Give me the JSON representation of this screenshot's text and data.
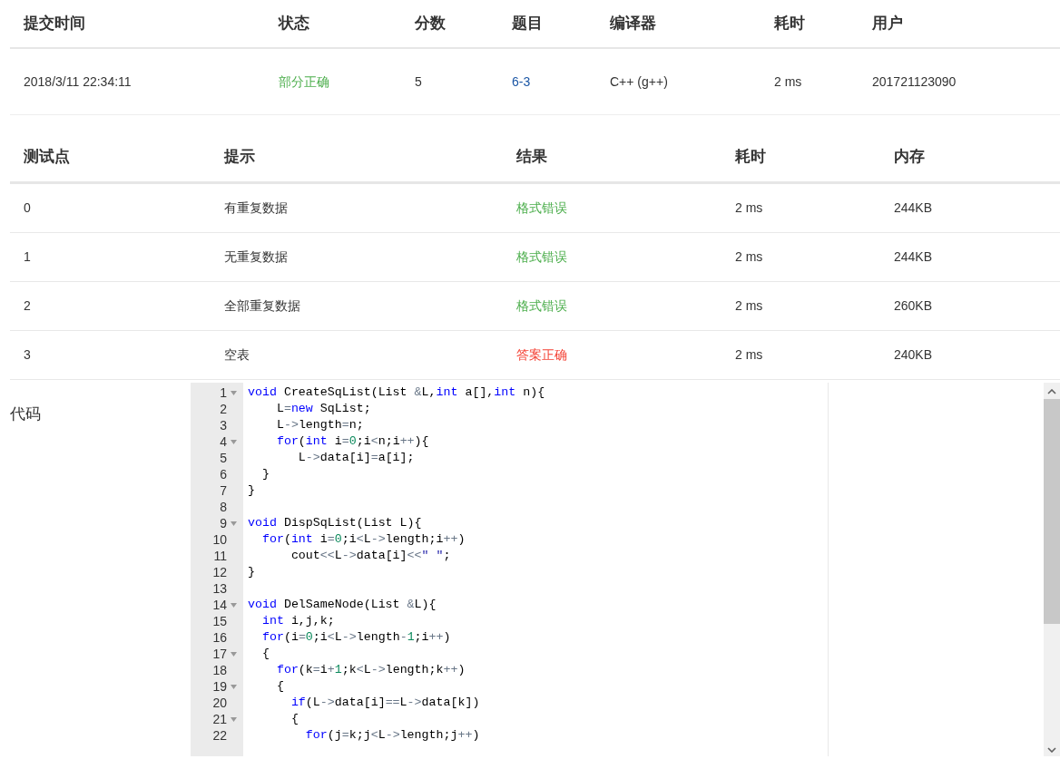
{
  "submission": {
    "columns": [
      "提交时间",
      "状态",
      "分数",
      "题目",
      "编译器",
      "耗时",
      "用户"
    ],
    "row": {
      "time": "2018/3/11 22:34:11",
      "status": {
        "text": "部分正确",
        "color": "#4cae4c"
      },
      "score": "5",
      "problem": "6-3",
      "compiler": "C++ (g++)",
      "duration": "2 ms",
      "user": "201721123090"
    }
  },
  "tests": {
    "columns": [
      "测试点",
      "提示",
      "结果",
      "耗时",
      "内存"
    ],
    "rows": [
      {
        "id": "0",
        "hint": "有重复数据",
        "result": {
          "text": "格式错误",
          "color": "#4cae4c"
        },
        "duration": "2 ms",
        "memory": "244KB"
      },
      {
        "id": "1",
        "hint": "无重复数据",
        "result": {
          "text": "格式错误",
          "color": "#4cae4c"
        },
        "duration": "2 ms",
        "memory": "244KB"
      },
      {
        "id": "2",
        "hint": "全部重复数据",
        "result": {
          "text": "格式错误",
          "color": "#4cae4c"
        },
        "duration": "2 ms",
        "memory": "260KB"
      },
      {
        "id": "3",
        "hint": "空表",
        "result": {
          "text": "答案正确",
          "color": "#f44336"
        },
        "duration": "2 ms",
        "memory": "240KB"
      }
    ]
  },
  "code": {
    "label": "代码",
    "lines": [
      {
        "number": "1",
        "foldable": true,
        "tokens": [
          {
            "t": "void",
            "kind": "keyword"
          },
          {
            "t": " CreateSqList(List ",
            "kind": "plain"
          },
          {
            "t": "&",
            "kind": "operator"
          },
          {
            "t": "L,",
            "kind": "plain"
          },
          {
            "t": "int",
            "kind": "keyword"
          },
          {
            "t": " a[],",
            "kind": "plain"
          },
          {
            "t": "int",
            "kind": "keyword"
          },
          {
            "t": " n){",
            "kind": "plain"
          }
        ]
      },
      {
        "number": "2",
        "foldable": false,
        "tokens": [
          {
            "t": "    L",
            "kind": "plain"
          },
          {
            "t": "=",
            "kind": "operator"
          },
          {
            "t": "new",
            "kind": "keyword"
          },
          {
            "t": " SqList;",
            "kind": "plain"
          }
        ]
      },
      {
        "number": "3",
        "foldable": false,
        "tokens": [
          {
            "t": "    L",
            "kind": "plain"
          },
          {
            "t": "->",
            "kind": "operator"
          },
          {
            "t": "length",
            "kind": "plain"
          },
          {
            "t": "=",
            "kind": "operator"
          },
          {
            "t": "n;",
            "kind": "plain"
          }
        ]
      },
      {
        "number": "4",
        "foldable": true,
        "tokens": [
          {
            "t": "    for",
            "kind": "keyword"
          },
          {
            "t": "(",
            "kind": "plain"
          },
          {
            "t": "int",
            "kind": "keyword"
          },
          {
            "t": " i",
            "kind": "plain"
          },
          {
            "t": "=",
            "kind": "operator"
          },
          {
            "t": "0",
            "kind": "number"
          },
          {
            "t": ";i",
            "kind": "plain"
          },
          {
            "t": "<",
            "kind": "operator"
          },
          {
            "t": "n;i",
            "kind": "plain"
          },
          {
            "t": "++",
            "kind": "operator"
          },
          {
            "t": "){",
            "kind": "plain"
          }
        ]
      },
      {
        "number": "5",
        "foldable": false,
        "tokens": [
          {
            "t": "       L",
            "kind": "plain"
          },
          {
            "t": "->",
            "kind": "operator"
          },
          {
            "t": "data[i]",
            "kind": "plain"
          },
          {
            "t": "=",
            "kind": "operator"
          },
          {
            "t": "a[i];",
            "kind": "plain"
          }
        ]
      },
      {
        "number": "6",
        "foldable": false,
        "tokens": [
          {
            "t": "  }",
            "kind": "plain"
          }
        ]
      },
      {
        "number": "7",
        "foldable": false,
        "tokens": [
          {
            "t": "}",
            "kind": "plain"
          }
        ]
      },
      {
        "number": "8",
        "foldable": false
      },
      {
        "number": "9",
        "foldable": true,
        "tokens": [
          {
            "t": "void",
            "kind": "keyword"
          },
          {
            "t": " DispSqList(List L){",
            "kind": "plain"
          }
        ]
      },
      {
        "number": "10",
        "foldable": false,
        "tokens": [
          {
            "t": "  for",
            "kind": "keyword"
          },
          {
            "t": "(",
            "kind": "plain"
          },
          {
            "t": "int",
            "kind": "keyword"
          },
          {
            "t": " i",
            "kind": "plain"
          },
          {
            "t": "=",
            "kind": "operator"
          },
          {
            "t": "0",
            "kind": "number"
          },
          {
            "t": ";i",
            "kind": "plain"
          },
          {
            "t": "<",
            "kind": "operator"
          },
          {
            "t": "L",
            "kind": "plain"
          },
          {
            "t": "->",
            "kind": "operator"
          },
          {
            "t": "length;i",
            "kind": "plain"
          },
          {
            "t": "++",
            "kind": "operator"
          },
          {
            "t": ")",
            "kind": "plain"
          }
        ]
      },
      {
        "number": "11",
        "foldable": false,
        "tokens": [
          {
            "t": "      cout",
            "kind": "plain"
          },
          {
            "t": "<<",
            "kind": "operator"
          },
          {
            "t": "L",
            "kind": "plain"
          },
          {
            "t": "->",
            "kind": "operator"
          },
          {
            "t": "data[i]",
            "kind": "plain"
          },
          {
            "t": "<<",
            "kind": "operator"
          },
          {
            "t": "\" \"",
            "kind": "string"
          },
          {
            "t": ";",
            "kind": "plain"
          }
        ]
      },
      {
        "number": "12",
        "foldable": false,
        "tokens": [
          {
            "t": "}",
            "kind": "plain"
          }
        ]
      },
      {
        "number": "13",
        "foldable": false
      },
      {
        "number": "14",
        "foldable": true,
        "tokens": [
          {
            "t": "void",
            "kind": "keyword"
          },
          {
            "t": " DelSameNode(List ",
            "kind": "plain"
          },
          {
            "t": "&",
            "kind": "operator"
          },
          {
            "t": "L){",
            "kind": "plain"
          }
        ]
      },
      {
        "number": "15",
        "foldable": false,
        "tokens": [
          {
            "t": "  int",
            "kind": "keyword"
          },
          {
            "t": " i,j,k;",
            "kind": "plain"
          }
        ]
      },
      {
        "number": "16",
        "foldable": false,
        "tokens": [
          {
            "t": "  for",
            "kind": "keyword"
          },
          {
            "t": "(i",
            "kind": "plain"
          },
          {
            "t": "=",
            "kind": "operator"
          },
          {
            "t": "0",
            "kind": "number"
          },
          {
            "t": ";i",
            "kind": "plain"
          },
          {
            "t": "<",
            "kind": "operator"
          },
          {
            "t": "L",
            "kind": "plain"
          },
          {
            "t": "->",
            "kind": "operator"
          },
          {
            "t": "length",
            "kind": "plain"
          },
          {
            "t": "-",
            "kind": "operator"
          },
          {
            "t": "1",
            "kind": "number"
          },
          {
            "t": ";i",
            "kind": "plain"
          },
          {
            "t": "++",
            "kind": "operator"
          },
          {
            "t": ")",
            "kind": "plain"
          }
        ]
      },
      {
        "number": "17",
        "foldable": true,
        "tokens": [
          {
            "t": "  {",
            "kind": "plain"
          }
        ]
      },
      {
        "number": "18",
        "foldable": false,
        "tokens": [
          {
            "t": "    for",
            "kind": "keyword"
          },
          {
            "t": "(k",
            "kind": "plain"
          },
          {
            "t": "=",
            "kind": "operator"
          },
          {
            "t": "i",
            "kind": "plain"
          },
          {
            "t": "+",
            "kind": "operator"
          },
          {
            "t": "1",
            "kind": "number"
          },
          {
            "t": ";k",
            "kind": "plain"
          },
          {
            "t": "<",
            "kind": "operator"
          },
          {
            "t": "L",
            "kind": "plain"
          },
          {
            "t": "->",
            "kind": "operator"
          },
          {
            "t": "length;k",
            "kind": "plain"
          },
          {
            "t": "++",
            "kind": "operator"
          },
          {
            "t": ")",
            "kind": "plain"
          }
        ]
      },
      {
        "number": "19",
        "foldable": true,
        "tokens": [
          {
            "t": "    {",
            "kind": "plain"
          }
        ]
      },
      {
        "number": "20",
        "foldable": false,
        "tokens": [
          {
            "t": "      if",
            "kind": "keyword"
          },
          {
            "t": "(L",
            "kind": "plain"
          },
          {
            "t": "->",
            "kind": "operator"
          },
          {
            "t": "data[i]",
            "kind": "plain"
          },
          {
            "t": "==",
            "kind": "operator"
          },
          {
            "t": "L",
            "kind": "plain"
          },
          {
            "t": "->",
            "kind": "operator"
          },
          {
            "t": "data[k])",
            "kind": "plain"
          }
        ]
      },
      {
        "number": "21",
        "foldable": true,
        "tokens": [
          {
            "t": "      {",
            "kind": "plain"
          }
        ]
      },
      {
        "number": "22",
        "foldable": false,
        "tokens": [
          {
            "t": "        for",
            "kind": "keyword"
          },
          {
            "t": "(j",
            "kind": "plain"
          },
          {
            "t": "=",
            "kind": "operator"
          },
          {
            "t": "k;j",
            "kind": "plain"
          },
          {
            "t": "<",
            "kind": "operator"
          },
          {
            "t": "L",
            "kind": "plain"
          },
          {
            "t": "->",
            "kind": "operator"
          },
          {
            "t": "length;j",
            "kind": "plain"
          },
          {
            "t": "++",
            "kind": "operator"
          },
          {
            "t": ")",
            "kind": "plain"
          }
        ]
      }
    ]
  }
}
